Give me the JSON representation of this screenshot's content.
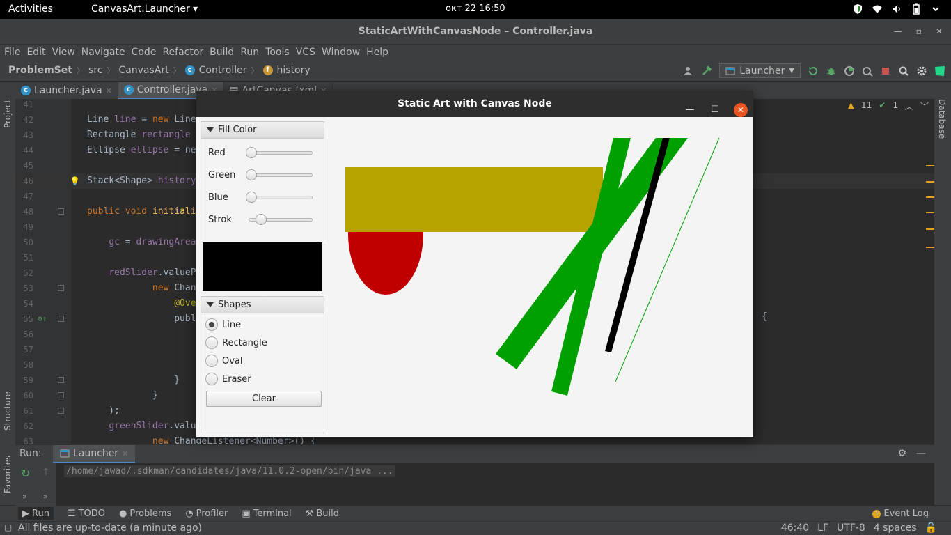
{
  "topbar": {
    "activities": "Activities",
    "app_menu": "CanvasArt.Launcher ▾",
    "clock": "окт 22  16:50"
  },
  "ide": {
    "window_title": "StaticArtWithCanvasNode – Controller.java",
    "menu": [
      "File",
      "Edit",
      "View",
      "Navigate",
      "Code",
      "Refactor",
      "Build",
      "Run",
      "Tools",
      "VCS",
      "Window",
      "Help"
    ],
    "breadcrumbs": {
      "project": "ProblemSet",
      "src": "src",
      "package": "CanvasArt",
      "class": "Controller",
      "field": "history"
    },
    "run_config": "Launcher",
    "tabs": [
      "Launcher.java",
      "Controller.java",
      "ArtCanvas.fxml"
    ],
    "side_labels": {
      "project": "Project",
      "structure": "Structure",
      "favorites": "Favorites",
      "database": "Database"
    },
    "inspections": {
      "warnings": "11",
      "ok": "1"
    },
    "code_lines": [
      {
        "n": "41",
        "text": ""
      },
      {
        "n": "42",
        "text": "Line line = new Line"
      },
      {
        "n": "43",
        "text": "Rectangle rectangle"
      },
      {
        "n": "44",
        "text": "Ellipse ellipse = ne"
      },
      {
        "n": "45",
        "text": ""
      },
      {
        "n": "46",
        "text": "Stack<Shape> history"
      },
      {
        "n": "47",
        "text": ""
      },
      {
        "n": "48",
        "text": "public void initiali"
      },
      {
        "n": "49",
        "text": ""
      },
      {
        "n": "50",
        "text": "    gc = drawingArea"
      },
      {
        "n": "51",
        "text": ""
      },
      {
        "n": "52",
        "text": "    redSlider.valueP"
      },
      {
        "n": "53",
        "text": "            new Chan"
      },
      {
        "n": "54",
        "text": "                @Ove"
      },
      {
        "n": "55",
        "text": "                publ"
      },
      {
        "n": "56",
        "text": ""
      },
      {
        "n": "57",
        "text": ""
      },
      {
        "n": "58",
        "text": ""
      },
      {
        "n": "59",
        "text": "                }"
      },
      {
        "n": "60",
        "text": "            }"
      },
      {
        "n": "61",
        "text": "    );"
      },
      {
        "n": "62",
        "text": "    greenSlider.valu"
      },
      {
        "n": "63",
        "text": "            new ChangeListener<Number>() {"
      }
    ],
    "line55_tail": "{",
    "run_panel": {
      "label": "Run:",
      "tab": "Launcher",
      "console_line": "/home/jawad/.sdkman/candidates/java/11.0.2-open/bin/java ..."
    },
    "bottom_tools": [
      "Run",
      "TODO",
      "Problems",
      "Profiler",
      "Terminal",
      "Build"
    ],
    "event_log": "Event Log",
    "event_count": "1",
    "status": {
      "message": "All files are up-to-date (a minute ago)",
      "position": "46:40",
      "line_sep": "LF",
      "encoding": "UTF-8",
      "indent": "4 spaces"
    }
  },
  "fx_window": {
    "title": "Static Art with Canvas Node",
    "fill_color": {
      "header": "Fill Color",
      "sliders": [
        {
          "label": "Red",
          "value": 0
        },
        {
          "label": "Green",
          "value": 0
        },
        {
          "label": "Blue",
          "value": 0
        },
        {
          "label": "Strok",
          "value": 0.15
        }
      ]
    },
    "preview_color": "#000000",
    "shapes": {
      "header": "Shapes",
      "options": [
        {
          "label": "Line",
          "selected": true
        },
        {
          "label": "Rectangle",
          "selected": false
        },
        {
          "label": "Oval",
          "selected": false
        },
        {
          "label": "Eraser",
          "selected": false
        }
      ],
      "clear_label": "Clear"
    }
  },
  "colors": {
    "ide_bg": "#2b2b2b",
    "ide_panel": "#3c3f41",
    "accent": "#4a88c7",
    "close_orange": "#e95420",
    "rect_fill": "#b8a200",
    "oval_fill": "#c00000",
    "green_stroke": "#00a000"
  }
}
